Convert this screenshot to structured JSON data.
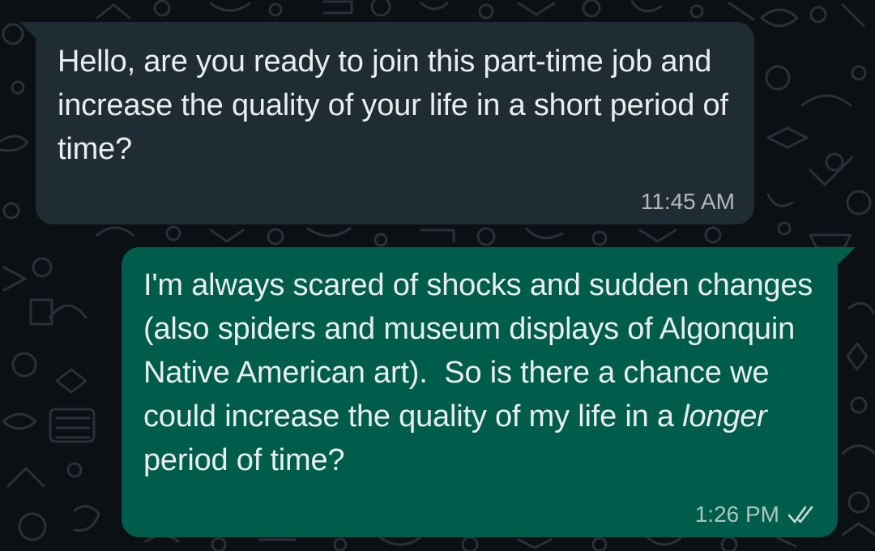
{
  "colors": {
    "background": "#0b1014",
    "incoming_bubble": "#202c33",
    "outgoing_bubble": "#005c4b",
    "text": "#e9edef",
    "read_receipt": "#d1d7db"
  },
  "conversation": {
    "messages": [
      {
        "direction": "incoming",
        "text": "Hello, are you ready to join this part-time job and increase the quality of your life in a short period of time?",
        "time": "11:45 AM"
      },
      {
        "direction": "outgoing",
        "text_before_emphasis": "I'm always scared of shocks and sudden changes (also spiders and museum displays of Algonquin Native American art).  So is there a chance we could increase the quality of my life in a ",
        "emphasis": "longer",
        "text_after_emphasis": " period of time?",
        "time": "1:26 PM",
        "status_icon": "double-check-icon"
      }
    ]
  }
}
